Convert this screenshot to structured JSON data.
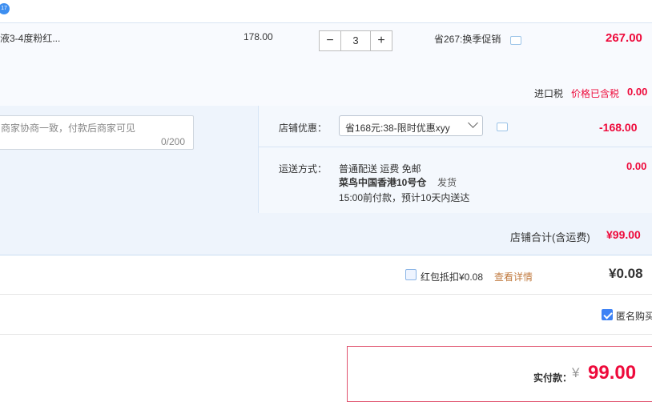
{
  "item": {
    "name": "液3-4度粉红...",
    "unit_price": "178.00",
    "quantity": "3",
    "minus_label": "−",
    "plus_label": "+",
    "promo_text": "省267:换季促销",
    "subtotal": "267.00",
    "tax_label": "进口税",
    "tax_note": "价格已含税",
    "tax_value": "0.00"
  },
  "message": {
    "placeholder": "商家协商一致，付款后商家可见",
    "counter": "0/200"
  },
  "shop_discount": {
    "label": "店铺优惠：",
    "selected": "省168元:38-限时优惠xyy",
    "value": "-168.00"
  },
  "shipping": {
    "label": "运送方式：",
    "line1": "普通配送 运费 免邮",
    "warehouse": "菜鸟中国香港10号仓",
    "ship_word": "发货",
    "line3": "15:00前付款，预计10天内送达",
    "value": "0.00"
  },
  "shop_total": {
    "label": "店铺合计(含运费)",
    "value": "¥99.00"
  },
  "redpacket": {
    "label": "红包抵扣¥0.08",
    "link": "查看详情",
    "value": "¥0.08"
  },
  "anonymous": {
    "label": "匿名购买"
  },
  "payment": {
    "label": "实付款：",
    "currency": "¥",
    "amount": "99.00"
  },
  "badge": {
    "text": "17"
  },
  "colors": {
    "accent_red": "#ee0a3b",
    "accent_blue": "#3d82f5",
    "link_brown": "#c07a3f"
  }
}
